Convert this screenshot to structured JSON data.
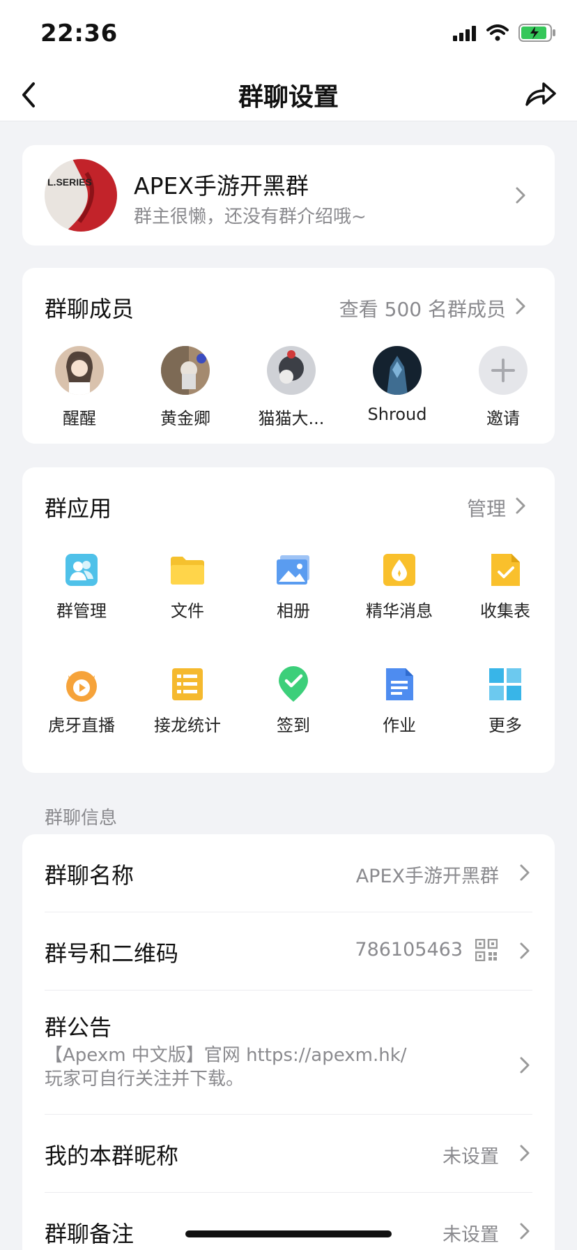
{
  "status": {
    "time": "22:36"
  },
  "nav": {
    "title": "群聊设置"
  },
  "group": {
    "name": "APEX手游开黑群",
    "description": "群主很懒，还没有群介绍哦~",
    "avatar_text": "L.SERIES"
  },
  "members": {
    "title": "群聊成员",
    "view_all": "查看 500 名群成员",
    "list": [
      {
        "name": "醒醒",
        "color": "#c9a88e"
      },
      {
        "name": "黄金卿",
        "color": "#8a7562"
      },
      {
        "name": "猫猫大...",
        "color": "#5a5e66"
      },
      {
        "name": "Shroud",
        "color": "#2d4a66"
      }
    ],
    "invite_label": "邀请"
  },
  "apps": {
    "title": "群应用",
    "manage": "管理",
    "items": [
      {
        "label": "群管理",
        "icon": "group-manage-icon"
      },
      {
        "label": "文件",
        "icon": "folder-icon"
      },
      {
        "label": "相册",
        "icon": "album-icon"
      },
      {
        "label": "精华消息",
        "icon": "essence-icon"
      },
      {
        "label": "收集表",
        "icon": "collect-form-icon"
      },
      {
        "label": "虎牙直播",
        "icon": "huya-icon"
      },
      {
        "label": "接龙统计",
        "icon": "relay-icon"
      },
      {
        "label": "签到",
        "icon": "checkin-icon"
      },
      {
        "label": "作业",
        "icon": "homework-icon"
      },
      {
        "label": "更多",
        "icon": "more-grid-icon"
      }
    ]
  },
  "info": {
    "section_label": "群聊信息",
    "name_title": "群聊名称",
    "name_value": "APEX手游开黑群",
    "id_title": "群号和二维码",
    "id_value": "786105463",
    "notice_title": "群公告",
    "notice_line1": "【Apexm 中文版】官网 https://apexm.hk/",
    "notice_line2": "玩家可自行关注并下载。",
    "nickname_title": "我的本群昵称",
    "nickname_value": "未设置",
    "remark_title": "群聊备注",
    "remark_value": "未设置"
  }
}
